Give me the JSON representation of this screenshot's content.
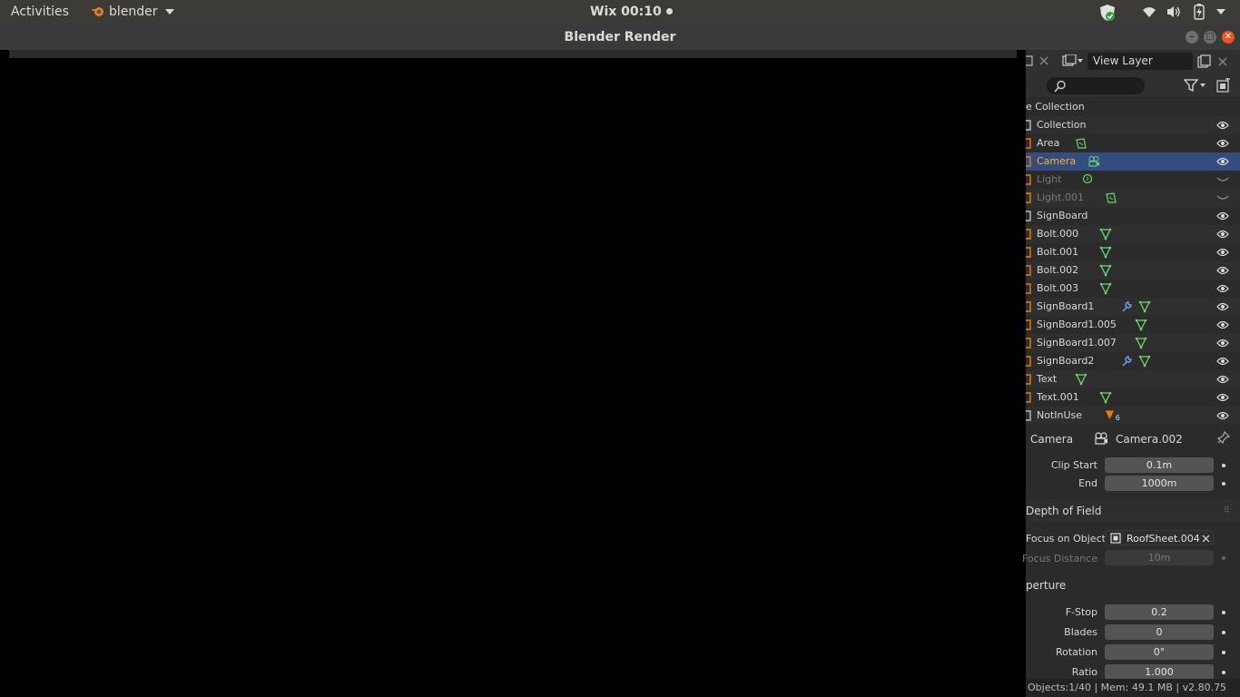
{
  "topbar": {
    "activities": "Activities",
    "app_name": "blender",
    "clock": "Wix 00:10"
  },
  "window": {
    "title": "Blender Render"
  },
  "view_layer": {
    "name": "View Layer"
  },
  "outliner": {
    "scene_collection": "e Collection",
    "rows": [
      {
        "label": "Collection",
        "type": "collection",
        "visible": true
      },
      {
        "label": "Area",
        "type": "light-area",
        "visible": true
      },
      {
        "label": "Camera",
        "type": "camera",
        "visible": true,
        "selected": true
      },
      {
        "label": "Light",
        "type": "light-point",
        "visible": false
      },
      {
        "label": "Light.001",
        "type": "light-area",
        "visible": false
      },
      {
        "label": "SignBoard",
        "type": "collection",
        "visible": true
      },
      {
        "label": "Bolt.000",
        "type": "mesh",
        "visible": true
      },
      {
        "label": "Bolt.001",
        "type": "mesh",
        "visible": true
      },
      {
        "label": "Bolt.002",
        "type": "mesh",
        "visible": true
      },
      {
        "label": "Bolt.003",
        "type": "mesh",
        "visible": true
      },
      {
        "label": "SignBoard1",
        "type": "mesh-modifier",
        "visible": true
      },
      {
        "label": "SignBoard1.005",
        "type": "mesh",
        "visible": true
      },
      {
        "label": "SignBoard1.007",
        "type": "mesh",
        "visible": true
      },
      {
        "label": "SignBoard2",
        "type": "mesh-modifier",
        "visible": true
      },
      {
        "label": "Text",
        "type": "mesh",
        "visible": true
      },
      {
        "label": "Text.001",
        "type": "mesh",
        "visible": true
      },
      {
        "label": "NotInUse",
        "type": "collection-count",
        "visible": true,
        "count": "6"
      }
    ]
  },
  "properties": {
    "object_label": "Camera",
    "data_name": "Camera.002",
    "clip_start_label": "Clip Start",
    "clip_start_value": "0.1m",
    "clip_end_label": "End",
    "clip_end_value": "1000m",
    "dof_section": "Depth of Field",
    "focus_object_label": "Focus on Object",
    "focus_object_value": "RoofSheet.004",
    "focus_distance_label": "Focus Distance",
    "focus_distance_value": "10m",
    "aperture_section": "perture",
    "fstop_label": "F-Stop",
    "fstop_value": "0.2",
    "blades_label": "Blades",
    "blades_value": "0",
    "rotation_label": "Rotation",
    "rotation_value": "0°",
    "ratio_label": "Ratio",
    "ratio_value": "1.000"
  },
  "status_bar": "Objects:1/40 | Mem: 49.1 MB | v2.80.75",
  "colors": {
    "selection": "#334d80",
    "selected_text": "#ffaf29",
    "mesh_icon": "#6cd56c",
    "modifier_icon": "#6fa0e6",
    "close_button": "#e95420"
  }
}
